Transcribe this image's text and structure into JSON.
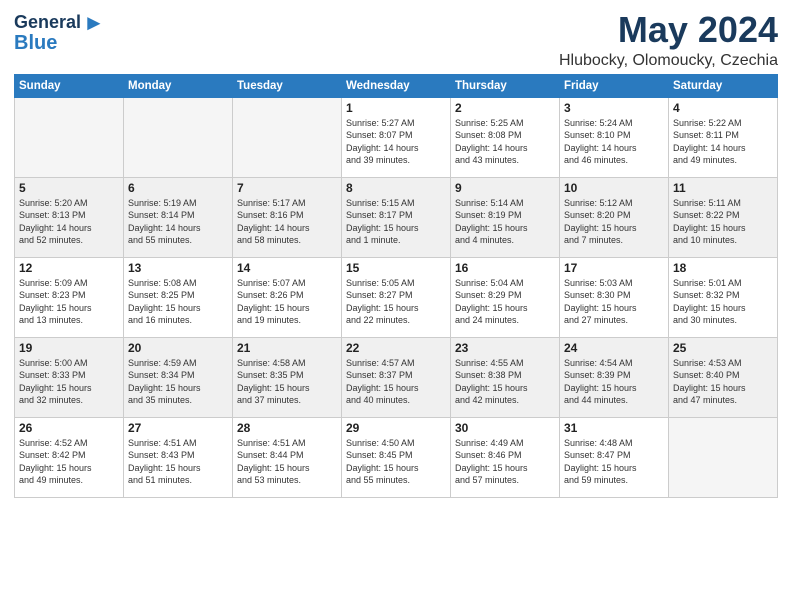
{
  "header": {
    "logo_line1": "General",
    "logo_line2": "Blue",
    "month": "May 2024",
    "location": "Hlubocky, Olomoucky, Czechia"
  },
  "days_of_week": [
    "Sunday",
    "Monday",
    "Tuesday",
    "Wednesday",
    "Thursday",
    "Friday",
    "Saturday"
  ],
  "weeks": [
    [
      {
        "day": "",
        "info": ""
      },
      {
        "day": "",
        "info": ""
      },
      {
        "day": "",
        "info": ""
      },
      {
        "day": "1",
        "info": "Sunrise: 5:27 AM\nSunset: 8:07 PM\nDaylight: 14 hours\nand 39 minutes."
      },
      {
        "day": "2",
        "info": "Sunrise: 5:25 AM\nSunset: 8:08 PM\nDaylight: 14 hours\nand 43 minutes."
      },
      {
        "day": "3",
        "info": "Sunrise: 5:24 AM\nSunset: 8:10 PM\nDaylight: 14 hours\nand 46 minutes."
      },
      {
        "day": "4",
        "info": "Sunrise: 5:22 AM\nSunset: 8:11 PM\nDaylight: 14 hours\nand 49 minutes."
      }
    ],
    [
      {
        "day": "5",
        "info": "Sunrise: 5:20 AM\nSunset: 8:13 PM\nDaylight: 14 hours\nand 52 minutes."
      },
      {
        "day": "6",
        "info": "Sunrise: 5:19 AM\nSunset: 8:14 PM\nDaylight: 14 hours\nand 55 minutes."
      },
      {
        "day": "7",
        "info": "Sunrise: 5:17 AM\nSunset: 8:16 PM\nDaylight: 14 hours\nand 58 minutes."
      },
      {
        "day": "8",
        "info": "Sunrise: 5:15 AM\nSunset: 8:17 PM\nDaylight: 15 hours\nand 1 minute."
      },
      {
        "day": "9",
        "info": "Sunrise: 5:14 AM\nSunset: 8:19 PM\nDaylight: 15 hours\nand 4 minutes."
      },
      {
        "day": "10",
        "info": "Sunrise: 5:12 AM\nSunset: 8:20 PM\nDaylight: 15 hours\nand 7 minutes."
      },
      {
        "day": "11",
        "info": "Sunrise: 5:11 AM\nSunset: 8:22 PM\nDaylight: 15 hours\nand 10 minutes."
      }
    ],
    [
      {
        "day": "12",
        "info": "Sunrise: 5:09 AM\nSunset: 8:23 PM\nDaylight: 15 hours\nand 13 minutes."
      },
      {
        "day": "13",
        "info": "Sunrise: 5:08 AM\nSunset: 8:25 PM\nDaylight: 15 hours\nand 16 minutes."
      },
      {
        "day": "14",
        "info": "Sunrise: 5:07 AM\nSunset: 8:26 PM\nDaylight: 15 hours\nand 19 minutes."
      },
      {
        "day": "15",
        "info": "Sunrise: 5:05 AM\nSunset: 8:27 PM\nDaylight: 15 hours\nand 22 minutes."
      },
      {
        "day": "16",
        "info": "Sunrise: 5:04 AM\nSunset: 8:29 PM\nDaylight: 15 hours\nand 24 minutes."
      },
      {
        "day": "17",
        "info": "Sunrise: 5:03 AM\nSunset: 8:30 PM\nDaylight: 15 hours\nand 27 minutes."
      },
      {
        "day": "18",
        "info": "Sunrise: 5:01 AM\nSunset: 8:32 PM\nDaylight: 15 hours\nand 30 minutes."
      }
    ],
    [
      {
        "day": "19",
        "info": "Sunrise: 5:00 AM\nSunset: 8:33 PM\nDaylight: 15 hours\nand 32 minutes."
      },
      {
        "day": "20",
        "info": "Sunrise: 4:59 AM\nSunset: 8:34 PM\nDaylight: 15 hours\nand 35 minutes."
      },
      {
        "day": "21",
        "info": "Sunrise: 4:58 AM\nSunset: 8:35 PM\nDaylight: 15 hours\nand 37 minutes."
      },
      {
        "day": "22",
        "info": "Sunrise: 4:57 AM\nSunset: 8:37 PM\nDaylight: 15 hours\nand 40 minutes."
      },
      {
        "day": "23",
        "info": "Sunrise: 4:55 AM\nSunset: 8:38 PM\nDaylight: 15 hours\nand 42 minutes."
      },
      {
        "day": "24",
        "info": "Sunrise: 4:54 AM\nSunset: 8:39 PM\nDaylight: 15 hours\nand 44 minutes."
      },
      {
        "day": "25",
        "info": "Sunrise: 4:53 AM\nSunset: 8:40 PM\nDaylight: 15 hours\nand 47 minutes."
      }
    ],
    [
      {
        "day": "26",
        "info": "Sunrise: 4:52 AM\nSunset: 8:42 PM\nDaylight: 15 hours\nand 49 minutes."
      },
      {
        "day": "27",
        "info": "Sunrise: 4:51 AM\nSunset: 8:43 PM\nDaylight: 15 hours\nand 51 minutes."
      },
      {
        "day": "28",
        "info": "Sunrise: 4:51 AM\nSunset: 8:44 PM\nDaylight: 15 hours\nand 53 minutes."
      },
      {
        "day": "29",
        "info": "Sunrise: 4:50 AM\nSunset: 8:45 PM\nDaylight: 15 hours\nand 55 minutes."
      },
      {
        "day": "30",
        "info": "Sunrise: 4:49 AM\nSunset: 8:46 PM\nDaylight: 15 hours\nand 57 minutes."
      },
      {
        "day": "31",
        "info": "Sunrise: 4:48 AM\nSunset: 8:47 PM\nDaylight: 15 hours\nand 59 minutes."
      },
      {
        "day": "",
        "info": ""
      }
    ]
  ]
}
